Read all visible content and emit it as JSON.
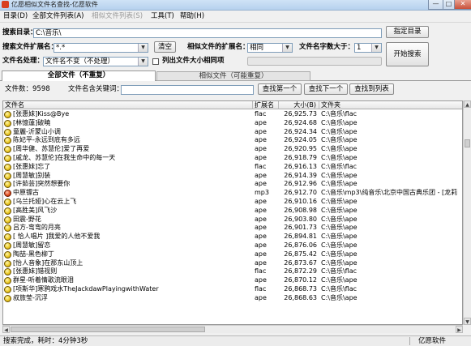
{
  "window": {
    "title": "亿愿相似文件名查找-亿愿软件",
    "buttons": [
      "—",
      "□",
      "✕"
    ]
  },
  "menu": [
    "目录(D)",
    "全部文件列表(A)",
    "相似文件列表(S)",
    "工具(T)",
    "帮助(H)"
  ],
  "search": {
    "dir_label": "搜索目录：",
    "dir_value": "C:\\音乐\\",
    "ext_label": "搜索文件扩展名：",
    "ext_value": "*.*",
    "clear_label": "清空",
    "similar_ext_label": "相似文件的扩展名：",
    "similar_ext_value": "相同",
    "min_len_label": "文件名字数大于：",
    "min_len_value": "1",
    "name_proc_label": "文件名处理：",
    "name_proc_value": "文件名不变（不处理）",
    "list_size_label": "列出文件大小相同项",
    "select_dir_label": "指定目录",
    "start_label": "开始搜索"
  },
  "tabs": [
    "全部文件（不重复）",
    "相似文件（可能重复）"
  ],
  "find": {
    "count_label": "文件数：9598",
    "keyword_label": "文件名含关键词：",
    "keyword_value": "",
    "find_first": "查找第一个",
    "find_next": "查找下一个",
    "find_to_list": "查找到列表"
  },
  "grid": {
    "headers": [
      "文件名",
      "扩展名",
      "大小(B)",
      "文件夹"
    ],
    "rows": [
      {
        "name": "[张惠妹]Kiss@Bye",
        "ext": "flac",
        "size": "26,925.73",
        "folder": "C:\\音乐\\flac",
        "icon": "yellow"
      },
      {
        "name": "[林憶蓮]破曉",
        "ext": "ape",
        "size": "26,924.68",
        "folder": "C:\\音乐\\ape",
        "icon": "yellow"
      },
      {
        "name": "童麗-沂蒙山小调",
        "ext": "ape",
        "size": "26,924.34",
        "folder": "C:\\音乐\\ape",
        "icon": "yellow"
      },
      {
        "name": "陈妃平-永远到底有多远",
        "ext": "ape",
        "size": "26,924.05",
        "folder": "C:\\音乐\\ape",
        "icon": "yellow"
      },
      {
        "name": "[周华健、苏慧伦]爱了再爱",
        "ext": "ape",
        "size": "26,920.95",
        "folder": "C:\\音乐\\ape",
        "icon": "yellow"
      },
      {
        "name": "[戚龙、苏慧伦]在我生命中的每一天",
        "ext": "ape",
        "size": "26,918.79",
        "folder": "C:\\音乐\\ape",
        "icon": "yellow"
      },
      {
        "name": "[张惠妹]忘了",
        "ext": "flac",
        "size": "26,916.13",
        "folder": "C:\\音乐\\flac",
        "icon": "yellow"
      },
      {
        "name": "[周慧敏]别装",
        "ext": "ape",
        "size": "26,914.39",
        "folder": "C:\\音乐\\ape",
        "icon": "yellow"
      },
      {
        "name": "[许茹芸]突然想要你",
        "ext": "ape",
        "size": "26,912.96",
        "folder": "C:\\音乐\\ape",
        "icon": "yellow"
      },
      {
        "name": "中原镖古",
        "ext": "mp3",
        "size": "26,912.70",
        "folder": "C:\\音乐\\mp3\\纯音乐\\北京中国古典乐团 - [龙莉",
        "icon": "red"
      },
      {
        "name": "[乌兰托娅]心在云上飞",
        "ext": "ape",
        "size": "26,910.16",
        "folder": "C:\\音乐\\ape",
        "icon": "yellow"
      },
      {
        "name": "[高胜美]风飞沙",
        "ext": "ape",
        "size": "26,908.98",
        "folder": "C:\\音乐\\ape",
        "icon": "yellow"
      },
      {
        "name": "田震-野花",
        "ext": "ape",
        "size": "26,903.80",
        "folder": "C:\\音乐\\ape",
        "icon": "yellow"
      },
      {
        "name": "吕方-弯弯的月亮",
        "ext": "ape",
        "size": "26,901.73",
        "folder": "C:\\音乐\\ape",
        "icon": "yellow"
      },
      {
        "name": "[ 恰人唱片 ]我爱的人他不爱我",
        "ext": "ape",
        "size": "26,894.81",
        "folder": "C:\\音乐\\ape",
        "icon": "yellow"
      },
      {
        "name": "[周慧敏]留恋",
        "ext": "ape",
        "size": "26,876.06",
        "folder": "C:\\音乐\\ape",
        "icon": "yellow"
      },
      {
        "name": "陶喆-黑色柳丁",
        "ext": "ape",
        "size": "26,875.42",
        "folder": "C:\\音乐\\ape",
        "icon": "yellow"
      },
      {
        "name": "[怡人音象]在那东山顶上",
        "ext": "ape",
        "size": "26,873.67",
        "folder": "C:\\音乐\\ape",
        "icon": "yellow"
      },
      {
        "name": "[张惠妹]错视则",
        "ext": "flac",
        "size": "26,872.29",
        "folder": "C:\\音乐\\flac",
        "icon": "yellow"
      },
      {
        "name": "群星-听着情歌流眼泪",
        "ext": "ape",
        "size": "26,870.12",
        "folder": "C:\\音乐\\ape",
        "icon": "yellow"
      },
      {
        "name": "[项斯华]寒鸦戏水TheJackdawPlayingwithWater",
        "ext": "flac",
        "size": "26,868.73",
        "folder": "C:\\音乐\\flac",
        "icon": "yellow"
      },
      {
        "name": "叔旅莹-沉浮",
        "ext": "ape",
        "size": "26,868.63",
        "folder": "C:\\音乐\\ape",
        "icon": "yellow"
      }
    ]
  },
  "status": {
    "left": "搜索完成，耗时：4分钟3秒",
    "right": "亿愿软件"
  }
}
